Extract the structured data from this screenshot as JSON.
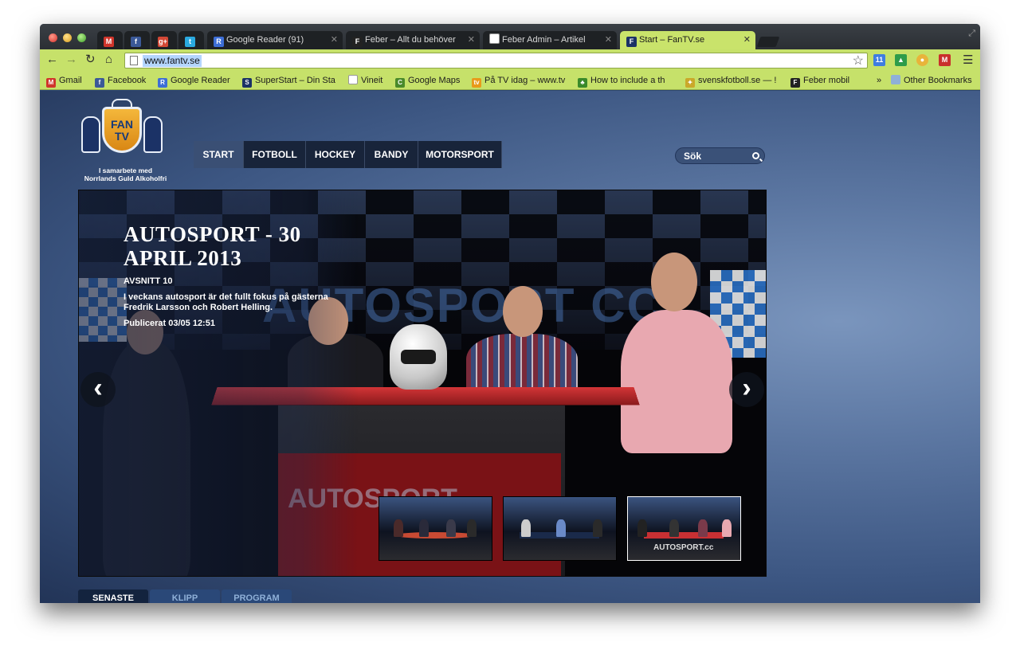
{
  "browser": {
    "tabs": [
      {
        "title": "",
        "icon": "gmail-icon",
        "color": "#d0352b",
        "glyph": "M"
      },
      {
        "title": "",
        "icon": "facebook-icon",
        "color": "#3b5998",
        "glyph": "f"
      },
      {
        "title": "",
        "icon": "google-plus-icon",
        "color": "#d34836",
        "glyph": "g+"
      },
      {
        "title": "",
        "icon": "twitter-icon",
        "color": "#2aa9e0",
        "glyph": "t"
      },
      {
        "title": "Google Reader (91)",
        "icon": "google-reader-icon",
        "color": "#3d6ed6",
        "glyph": "R"
      },
      {
        "title": "Feber – Allt du behöver",
        "icon": "feber-icon",
        "color": "#222222",
        "glyph": "F"
      },
      {
        "title": "Feber Admin – Artikel",
        "icon": "page-icon",
        "color": "#ffffff",
        "glyph": ""
      },
      {
        "title": "Start – FanTV.se",
        "icon": "fantv-icon",
        "color": "#1b3266",
        "glyph": "F"
      }
    ],
    "url": "www.fantv.se",
    "extensions": [
      {
        "icon": "calendar-icon",
        "color": "#3f7de0",
        "glyph": "11"
      },
      {
        "icon": "drive-icon",
        "color": "#2d9c4a",
        "glyph": "▲"
      },
      {
        "icon": "monkey-icon",
        "color": "#e8b43a",
        "glyph": "●"
      },
      {
        "icon": "gmail-checker-icon",
        "color": "#c9302c",
        "glyph": "M"
      }
    ],
    "bookmarks": [
      {
        "label": "Gmail",
        "icon": "gmail-icon",
        "color": "#d0352b",
        "glyph": "M"
      },
      {
        "label": "Facebook",
        "icon": "facebook-icon",
        "color": "#3b5998",
        "glyph": "f"
      },
      {
        "label": "Google Reader",
        "icon": "google-reader-icon",
        "color": "#3d6ed6",
        "glyph": "R"
      },
      {
        "label": "SuperStart – Din Sta",
        "icon": "superstart-icon",
        "color": "#1b3266",
        "glyph": "S"
      },
      {
        "label": "Vineit",
        "icon": "page-icon",
        "color": "#ffffff",
        "glyph": ""
      },
      {
        "label": "Google Maps",
        "icon": "google-maps-icon",
        "color": "#4a8a2a",
        "glyph": "C"
      },
      {
        "label": "På TV idag – www.tv",
        "icon": "tv-icon",
        "color": "#e89a1a",
        "glyph": "tv"
      },
      {
        "label": "How to include a th",
        "icon": "leaf-icon",
        "color": "#3a8a2a",
        "glyph": "♣"
      },
      {
        "label": "svenskfotboll.se — !",
        "icon": "svenskfotboll-icon",
        "color": "#caa82a",
        "glyph": "✦"
      },
      {
        "label": "Feber mobil",
        "icon": "feber-icon",
        "color": "#222222",
        "glyph": "F"
      }
    ],
    "bookmarks_overflow": "»",
    "other_bookmarks": "Other Bookmarks"
  },
  "site": {
    "logo_fan": "FAN",
    "logo_tv": "TV",
    "logo_tagline_1": "I samarbete med",
    "logo_tagline_2": "Norrlands Guld Alkoholfri",
    "nav": [
      {
        "label": "START",
        "active": true
      },
      {
        "label": "FOTBOLL",
        "active": false
      },
      {
        "label": "HOCKEY",
        "active": false
      },
      {
        "label": "BANDY",
        "active": false
      },
      {
        "label": "MOTORSPORT",
        "active": false
      }
    ],
    "search_placeholder": "Sök",
    "hero": {
      "title": "AUTOSPORT - 30 APRIL 2013",
      "episode": "AVSNITT 10",
      "description": "I veckans autosport är det fullt fokus på gästerna Fredrik Larsson och Robert Helling.",
      "published": "Publicerat 03/05 12:51",
      "backdrop_text": "AUTOSPORT CC",
      "desk_text": "AUTOSPORT",
      "prev_label": "‹",
      "next_label": "›"
    },
    "thumbnails": [
      {
        "label": "",
        "selected": false
      },
      {
        "label": "",
        "selected": false
      },
      {
        "label": "AUTOSPORT.cc",
        "selected": true
      }
    ],
    "subtabs": [
      {
        "label": "SENASTE",
        "active": true
      },
      {
        "label": "KLIPP",
        "active": false
      },
      {
        "label": "PROGRAM",
        "active": false
      }
    ]
  }
}
